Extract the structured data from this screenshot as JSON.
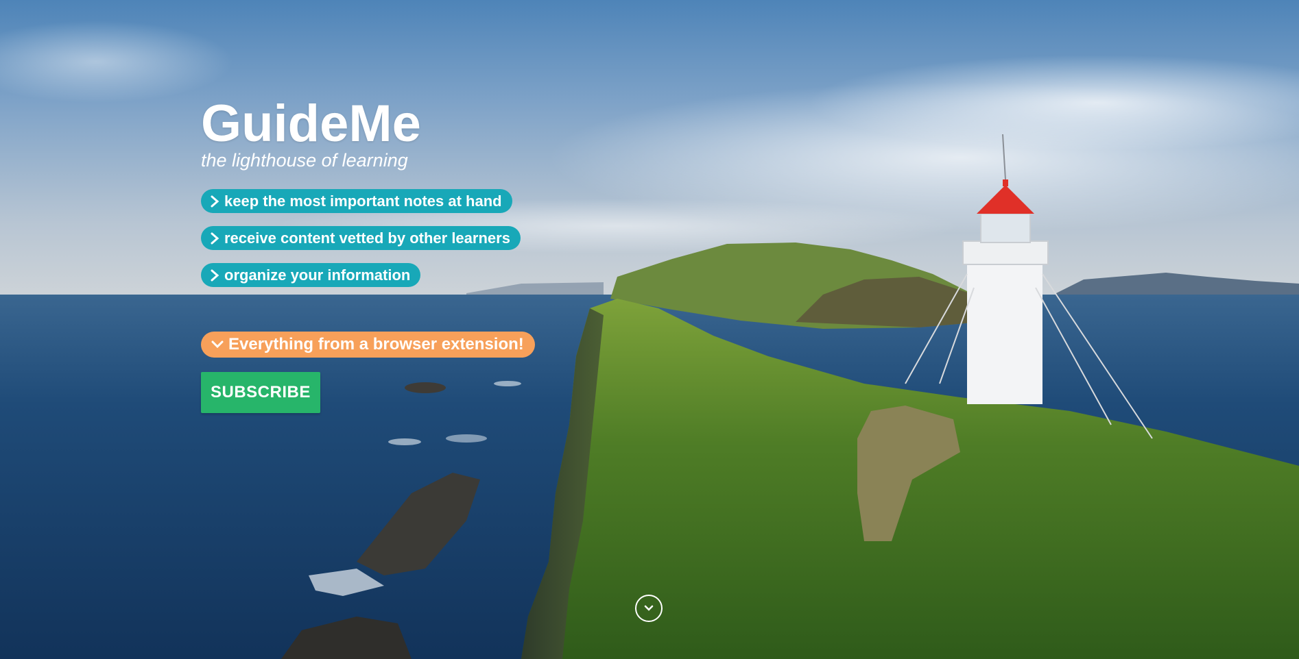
{
  "hero": {
    "title": "GuideMe",
    "subtitle": "the lighthouse of learning",
    "features": [
      {
        "label": "keep the most important notes at hand",
        "icon": "chevron-right-icon"
      },
      {
        "label": "receive content vetted by other learners",
        "icon": "chevron-right-icon"
      },
      {
        "label": "organize your information",
        "icon": "chevron-right-icon"
      }
    ],
    "cta_banner": {
      "label": "Everything from a browser extension!",
      "icon": "chevron-down-icon"
    },
    "subscribe_label": "SUBSCRIBE",
    "scroll_icon": "chevron-down-circle-icon"
  },
  "colors": {
    "feature_pill": "#18a8b8",
    "cta_pill": "#f7a05a",
    "subscribe_button": "#27b56a",
    "lighthouse_roof": "#e03028"
  }
}
